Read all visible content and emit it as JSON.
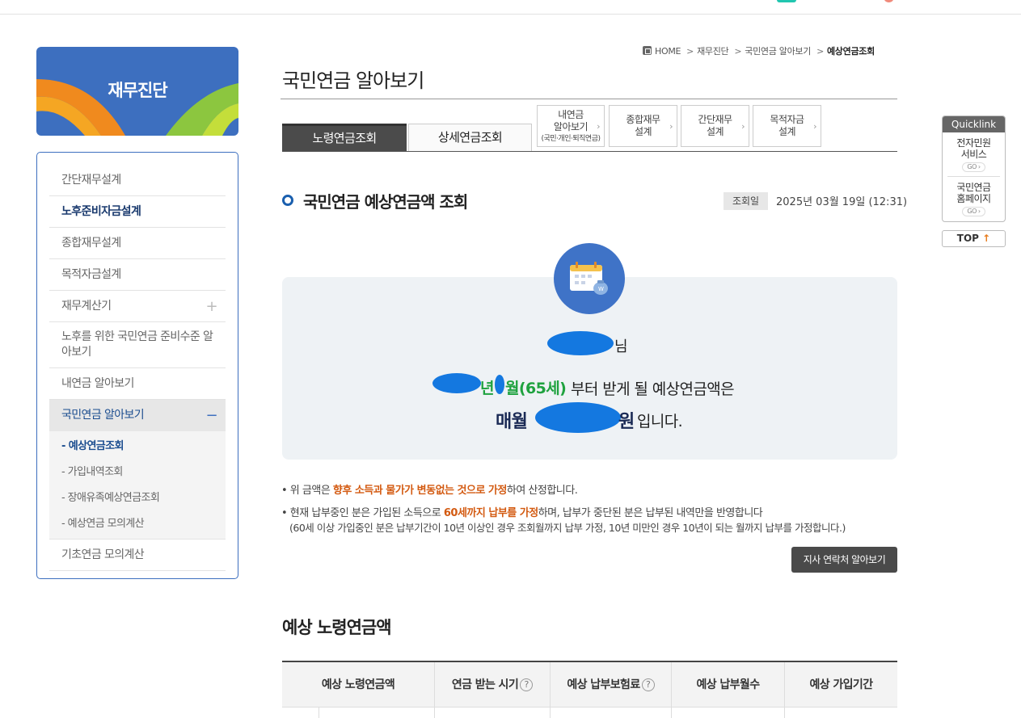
{
  "sidebar": {
    "banner_title": "재무진단",
    "items": [
      {
        "label": "간단재무설계"
      },
      {
        "label": "노후준비자금설계"
      },
      {
        "label": "종합재무설계"
      },
      {
        "label": "목적자금설계"
      },
      {
        "label": "재무계산기",
        "expander": "+"
      },
      {
        "label": "노후를 위한 국민연금 준비수준 알아보기"
      },
      {
        "label": "내연금 알아보기"
      },
      {
        "label": "국민연금 알아보기",
        "expander": "−"
      },
      {
        "label": "기초연금 모의계산"
      }
    ],
    "subitems": [
      {
        "label": "- 예상연금조회"
      },
      {
        "label": "- 가입내역조회"
      },
      {
        "label": "- 장애유족예상연금조회"
      },
      {
        "label": "- 예상연금 모의계산"
      }
    ]
  },
  "breadcrumb": {
    "items": [
      "HOME",
      "재무진단",
      "국민연금 알아보기",
      "예상연금조회"
    ],
    "separator": ">"
  },
  "page_title": "국민연금 알아보기",
  "tabs": {
    "main": [
      "노령연금조회",
      "상세연금조회"
    ],
    "boxes": [
      {
        "line1": "내연금",
        "line2": "알아보기",
        "small": "(국민·개인·퇴직연금)"
      },
      {
        "line1": "종합재무",
        "line2": "설계"
      },
      {
        "line1": "간단재무",
        "line2": "설계"
      },
      {
        "line1": "목적자금",
        "line2": "설계"
      }
    ],
    "chevron": "›"
  },
  "section": {
    "title": "국민연금 예상연금액 조회",
    "date_label": "조회일",
    "date_value": "2025년 03월 19일 (12:31)"
  },
  "result": {
    "name_suffix": "님",
    "year_suffix": "년",
    "month_suffix": "월(65세)",
    "line2_rest": "부터 받게 될 예상연금액은",
    "monthly": "매월",
    "won": "원",
    "ending": "입니다."
  },
  "notes": {
    "n1_pre": "• 위 금액은 ",
    "n1_hl": "향후 소득과 물가가 변동없는 것으로 가정",
    "n1_post": "하여 산정합니다.",
    "n2_pre": "• 현재 납부중인 분은 가입된 소득으로 ",
    "n2_hl": "60세까지 납부를 가정",
    "n2_post": "하며, 납부가 중단된 분은 납부된 내역만을 반영합니다",
    "n3": "(60세 이상 가입중인 분은 납부기간이 10년 이상인 경우 조회월까지 납부 가정, 10년 미만인 경우 10년이 되는 월까지 납부를 가정합니다.)"
  },
  "contact_button": "지사 연락처 알아보기",
  "section2_title": "예상 노령연금액",
  "table": {
    "headers": [
      {
        "label": "예상 노령연금액",
        "help": false
      },
      {
        "label": "연금 받는 시기",
        "help": true
      },
      {
        "label": "예상 납부보험료",
        "help": true
      },
      {
        "label": "예상 납부월수",
        "help": false
      },
      {
        "label": "예상 가입기간",
        "help": false
      }
    ],
    "help_glyph": "?"
  },
  "quicklink": {
    "header": "Quicklink",
    "links": [
      {
        "line1": "전자민원",
        "line2": "서비스",
        "go": "GO ›"
      },
      {
        "line1": "국민연금",
        "line2": "홈페이지",
        "go": "GO ›"
      }
    ],
    "top_label": "TOP",
    "top_arrow": "↑"
  },
  "colors": {
    "brand_blue": "#3d6fbf",
    "highlight_orange": "#d35a11",
    "age_green": "#1fa23f",
    "redaction_blue": "#1478e0"
  }
}
